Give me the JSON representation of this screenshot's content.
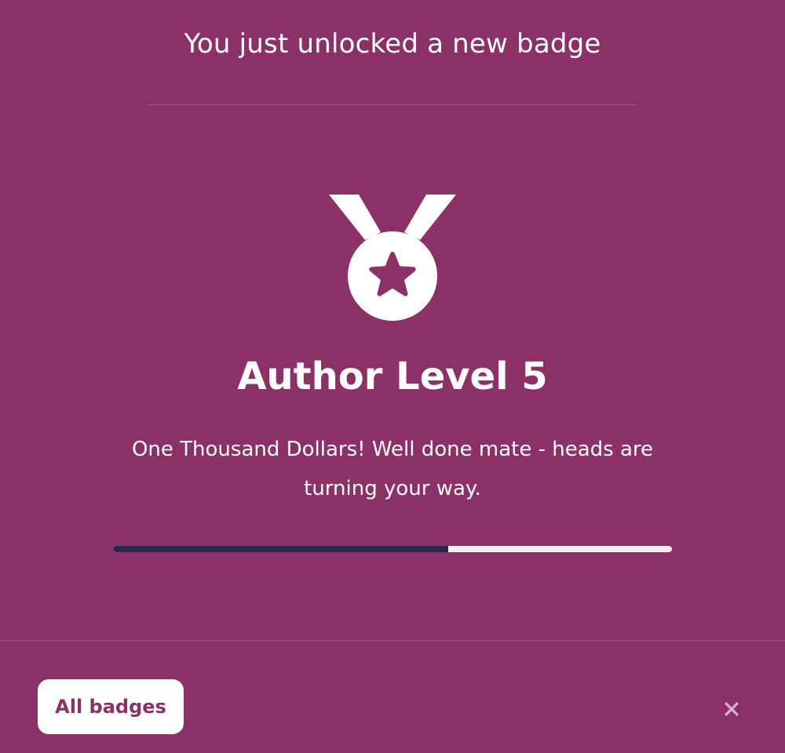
{
  "modal": {
    "heading": "You just unlocked a new badge",
    "badge": {
      "icon": "medal-star-icon",
      "title": "Author Level 5",
      "description": "One Thousand Dollars! Well done mate - heads are turning your way."
    },
    "progress": {
      "fraction": 0.6
    },
    "footer": {
      "all_badges_label": "All badges",
      "close_icon": "close-icon"
    }
  },
  "colors": {
    "background": "#8b3168",
    "progress_fill": "#262a4a",
    "progress_track": "#f3eef1",
    "button_text": "#8b3168"
  }
}
